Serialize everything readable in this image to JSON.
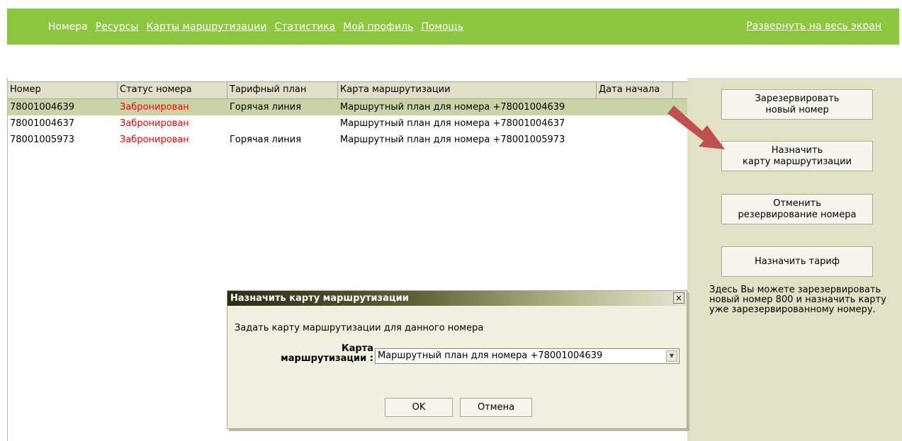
{
  "nav": {
    "items": [
      {
        "label": "Номера",
        "link": false
      },
      {
        "label": "Ресурсы",
        "link": true
      },
      {
        "label": "Карты маршрутизации",
        "link": true
      },
      {
        "label": "Статистика",
        "link": true
      },
      {
        "label": "Мой профиль",
        "link": true
      },
      {
        "label": "Помощь",
        "link": true
      }
    ],
    "fullscreen": "Развернуть на весь экран"
  },
  "table": {
    "columns": [
      "Номер",
      "Статус номера",
      "Тарифный план",
      "Карта маршрутизации",
      "Дата начала"
    ],
    "rows": [
      {
        "number": "78001004639",
        "status": "Забронирован",
        "tariff": "Горячая линия",
        "map": "Маршрутный план для номера +78001004639",
        "date": ""
      },
      {
        "number": "78001004637",
        "status": "Забронирован",
        "tariff": "",
        "map": "Маршрутный план для номера +78001004637",
        "date": ""
      },
      {
        "number": "78001005973",
        "status": "Забронирован",
        "tariff": "Горячая линия",
        "map": "Маршрутный план для номера +78001005973",
        "date": ""
      }
    ]
  },
  "sidebar": {
    "reserve": {
      "line1": "Зарезервировать",
      "line2": "новый номер"
    },
    "assign_map": {
      "line1": "Назначить",
      "line2": "карту маршрутизации"
    },
    "cancel_reserve": {
      "line1": "Отменить",
      "line2": "резервирование номера"
    },
    "assign_tariff": "Назначить тариф",
    "help_text": "Здесь Вы можете зарезервировать новый номер 800 и назначить карту уже зарезервированному номеру."
  },
  "dialog": {
    "title": "Назначить карту маршрутизации",
    "close": "×",
    "message": "Задать карту маршрутизации для данного номера",
    "label_line1": "Карта",
    "label_line2": "маршрутизации :",
    "selected": "Маршрутный план для номера +78001004639",
    "ok": "OK",
    "cancel": "Отмена"
  },
  "colors": {
    "nav_bg": "#8dc63f",
    "sidebar_bg": "#e1e1c5",
    "selected_row": "#c9d4a6",
    "status_red": "#ff0000",
    "arrow": "#c0504d"
  }
}
